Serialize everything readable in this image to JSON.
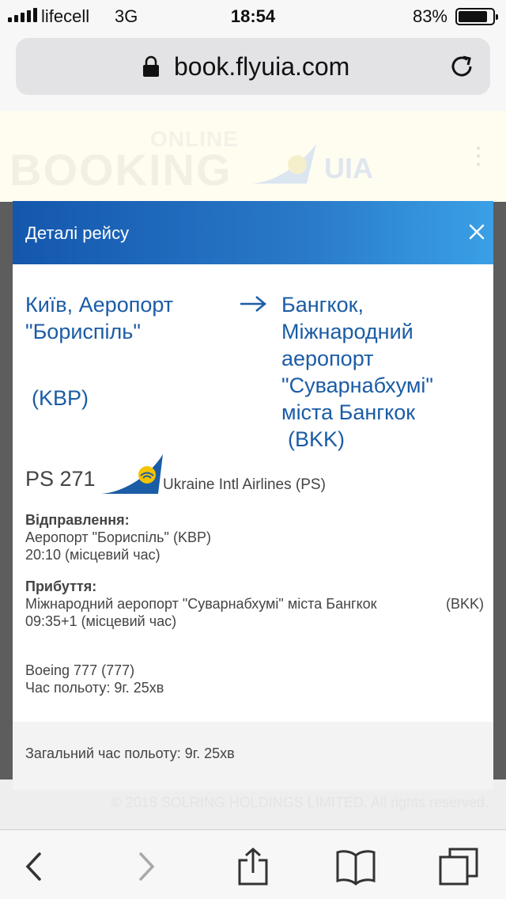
{
  "status_bar": {
    "carrier": "lifecell",
    "network": "3G",
    "time": "18:54",
    "battery": "83%"
  },
  "browser": {
    "url": "book.flyuia.com"
  },
  "background_page": {
    "header_online": "ONLINE",
    "header_booking": "BOOKING",
    "header_uia": "UIA",
    "copyright": "© 2018 SOLRING HOLDINGS LIMITED. All rights reserved."
  },
  "modal": {
    "title": "Деталі рейсу",
    "from_city": "Київ, Аеропорт \"Бориспіль\"",
    "from_code": "(KBP)",
    "to_city": "Бангкок, Міжнародний аеропорт \"Суварнабхумі\" міста Бангкок",
    "to_code": "(BKK)",
    "flight_number": "PS 271",
    "airline": "Ukraine Intl Airlines (PS)",
    "departure": {
      "label": "Відправлення:",
      "airport": "Аеропорт \"Бориспіль\" (KBP)",
      "time": "20:10 (місцевий час)"
    },
    "arrival": {
      "label": "Прибуття:",
      "airport": "Міжнародний аеропорт \"Суварнабхумі\" міста Бангкок",
      "code": "(BKK)",
      "time": "09:35+1 (місцевий час)"
    },
    "aircraft": "Boeing 777 (777)",
    "flight_time": "Час польоту: 9г. 25хв",
    "total_flight_time": "Загальний час польоту: 9г. 25хв"
  },
  "colors": {
    "brand_blue": "#1b5ca6",
    "header_gradient_start": "#1457ad",
    "header_gradient_end": "#3aa0e6",
    "logo_yellow": "#f5c400"
  },
  "icons": {
    "lock": "lock-icon",
    "reload": "reload-icon",
    "close": "close-icon",
    "arrow": "arrow-right-icon",
    "back": "back-icon",
    "forward": "forward-icon",
    "share": "share-icon",
    "bookmarks": "bookmarks-icon",
    "tabs": "tabs-icon"
  }
}
